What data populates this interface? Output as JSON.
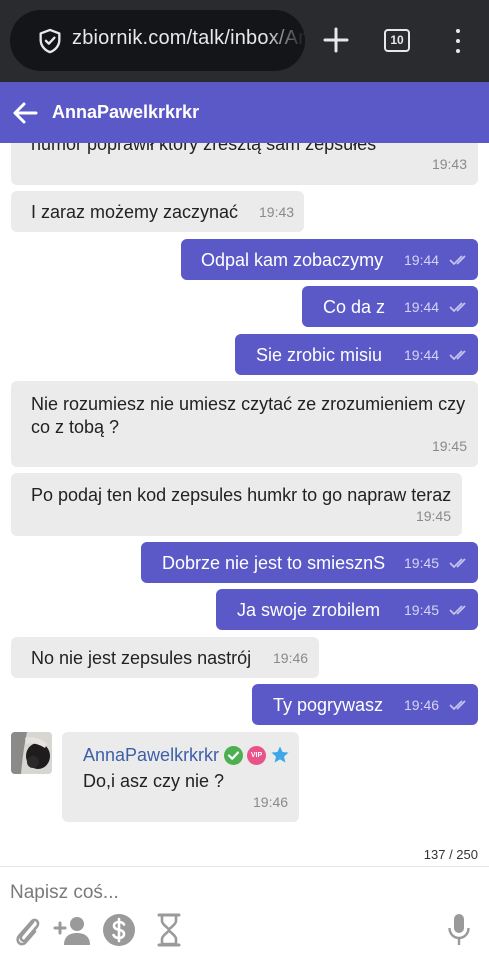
{
  "browser": {
    "url": "zbiornik.com/talk/inbox/AnnaPawelkrkrkr",
    "tab_count": "10"
  },
  "header": {
    "title": "AnnaPawelkrkrkr"
  },
  "messages": [
    {
      "dir": "in",
      "text": "humor poprawił który zresztą sam zepsułeś",
      "time": "19:43"
    },
    {
      "dir": "in",
      "text": "I zaraz możemy zaczynać",
      "time": "19:43"
    },
    {
      "dir": "out",
      "text": "Odpal kam zobaczymy",
      "time": "19:44"
    },
    {
      "dir": "out",
      "text": "Co da z",
      "time": "19:44"
    },
    {
      "dir": "out",
      "text": "Sie zrobic misiu",
      "time": "19:44"
    },
    {
      "dir": "in",
      "text_line1": "Nie rozumiesz nie umiesz czytać ze zrozumieniem czy",
      "text_line2": "co z tobą ?",
      "time": "19:45"
    },
    {
      "dir": "in",
      "text": "Po podaj ten kod zepsules humkr to go napraw teraz",
      "time": "19:45"
    },
    {
      "dir": "out",
      "text": "Dobrze nie jest to smiesznS",
      "time": "19:45"
    },
    {
      "dir": "out",
      "text": "Ja swoje zrobilem",
      "time": "19:45"
    },
    {
      "dir": "in",
      "text": "No nie jest zepsules nastrój",
      "time": "19:46"
    },
    {
      "dir": "out",
      "text": "Ty pogrywasz",
      "time": "19:46"
    },
    {
      "dir": "in",
      "sender": "AnnaPawelkrkrkr",
      "vip_label": "VIP",
      "text": "Do,i asz czy nie ?",
      "time": "19:46"
    }
  ],
  "char_counter": "137 / 250",
  "composer": {
    "placeholder": "Napisz coś..."
  },
  "icons": {
    "attach": "paperclip-icon",
    "add_person": "add-person-icon",
    "money": "dollar-icon",
    "timer": "hourglass-icon",
    "mic": "microphone-icon"
  },
  "colors": {
    "accent": "#5b59c7",
    "incoming_bubble": "#ebebeb",
    "browser_bar": "#2a2b2f"
  }
}
